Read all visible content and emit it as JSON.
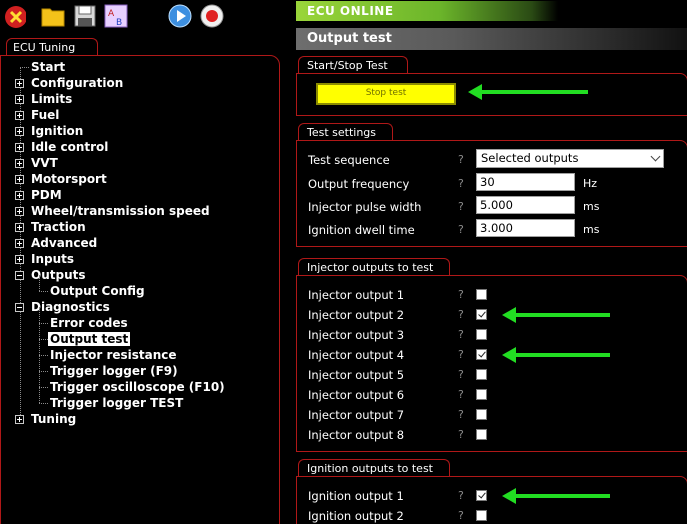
{
  "left_tab": "ECU Tuning",
  "tree": [
    {
      "label": "Start",
      "level": 0,
      "expander": "none",
      "selected": false
    },
    {
      "label": "Configuration",
      "level": 0,
      "expander": "plus",
      "selected": false
    },
    {
      "label": "Limits",
      "level": 0,
      "expander": "plus",
      "selected": false
    },
    {
      "label": "Fuel",
      "level": 0,
      "expander": "plus",
      "selected": false
    },
    {
      "label": "Ignition",
      "level": 0,
      "expander": "plus",
      "selected": false
    },
    {
      "label": "Idle control",
      "level": 0,
      "expander": "plus",
      "selected": false
    },
    {
      "label": "VVT",
      "level": 0,
      "expander": "plus",
      "selected": false
    },
    {
      "label": "Motorsport",
      "level": 0,
      "expander": "plus",
      "selected": false
    },
    {
      "label": "PDM",
      "level": 0,
      "expander": "plus",
      "selected": false
    },
    {
      "label": "Wheel/transmission speed",
      "level": 0,
      "expander": "plus",
      "selected": false
    },
    {
      "label": "Traction",
      "level": 0,
      "expander": "plus",
      "selected": false
    },
    {
      "label": "Advanced",
      "level": 0,
      "expander": "plus",
      "selected": false
    },
    {
      "label": "Inputs",
      "level": 0,
      "expander": "plus",
      "selected": false
    },
    {
      "label": "Outputs",
      "level": 0,
      "expander": "minus",
      "selected": false
    },
    {
      "label": "Output Config",
      "level": 1,
      "expander": "none",
      "selected": false
    },
    {
      "label": "Diagnostics",
      "level": 0,
      "expander": "minus",
      "selected": false
    },
    {
      "label": "Error codes",
      "level": 1,
      "expander": "none",
      "selected": false
    },
    {
      "label": "Output test",
      "level": 1,
      "expander": "none",
      "selected": true
    },
    {
      "label": "Injector resistance",
      "level": 1,
      "expander": "none",
      "selected": false
    },
    {
      "label": "Trigger logger (F9)",
      "level": 1,
      "expander": "none",
      "selected": false
    },
    {
      "label": "Trigger oscilloscope (F10)",
      "level": 1,
      "expander": "none",
      "selected": false
    },
    {
      "label": "Trigger logger TEST",
      "level": 1,
      "expander": "none",
      "selected": false
    },
    {
      "label": "Tuning",
      "level": 0,
      "expander": "plus",
      "selected": false
    }
  ],
  "status_banner": "ECU ONLINE",
  "page_title": "Output test",
  "start_stop": {
    "group_title": "Start/Stop Test",
    "button_label": "Stop test"
  },
  "test_settings": {
    "group_title": "Test settings",
    "rows": [
      {
        "label": "Test sequence",
        "kind": "select",
        "value": "Selected outputs",
        "unit": ""
      },
      {
        "label": "Output frequency",
        "kind": "input",
        "value": "30",
        "unit": "Hz"
      },
      {
        "label": "Injector pulse width",
        "kind": "input",
        "value": "5.000",
        "unit": "ms"
      },
      {
        "label": "Ignition dwell time",
        "kind": "input",
        "value": "3.000",
        "unit": "ms"
      }
    ]
  },
  "injector_outputs": {
    "group_title": "Injector outputs to test",
    "items": [
      {
        "label": "Injector output 1",
        "checked": false,
        "arrow": false
      },
      {
        "label": "Injector output 2",
        "checked": true,
        "arrow": true
      },
      {
        "label": "Injector output 3",
        "checked": false,
        "arrow": false
      },
      {
        "label": "Injector output 4",
        "checked": true,
        "arrow": true
      },
      {
        "label": "Injector output 5",
        "checked": false,
        "arrow": false
      },
      {
        "label": "Injector output 6",
        "checked": false,
        "arrow": false
      },
      {
        "label": "Injector output 7",
        "checked": false,
        "arrow": false
      },
      {
        "label": "Injector output 8",
        "checked": false,
        "arrow": false
      }
    ]
  },
  "ignition_outputs": {
    "group_title": "Ignition outputs to test",
    "items": [
      {
        "label": "Ignition output 1",
        "checked": true,
        "arrow": true
      },
      {
        "label": "Ignition output 2",
        "checked": false,
        "arrow": false
      }
    ]
  },
  "help_glyph": "?",
  "colors": {
    "accent_red": "#b01818",
    "online_green": "#9ad53a",
    "arrow_green": "#22dd22",
    "button_yellow": "#ffff00"
  },
  "toolbar_icons": [
    "close-icon",
    "open-folder-icon",
    "save-disk-icon",
    "compare-ab-icon",
    "play-icon",
    "record-icon"
  ]
}
